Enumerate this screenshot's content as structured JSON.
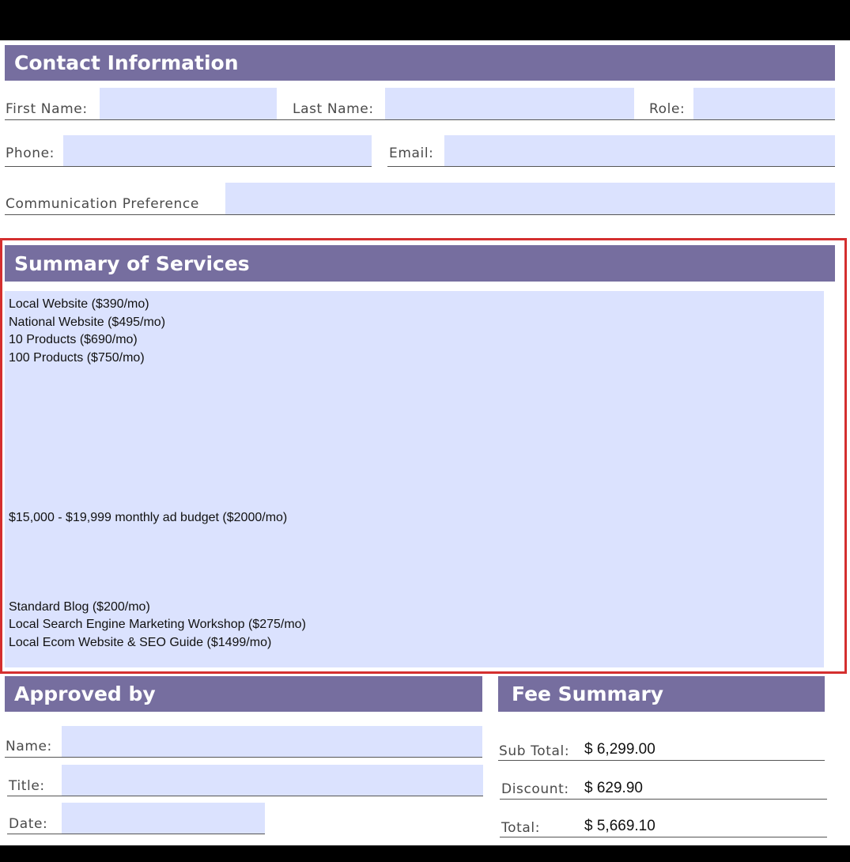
{
  "contact": {
    "header": "Contact Information",
    "first_name_label": "First Name:",
    "last_name_label": "Last Name:",
    "role_label": "Role:",
    "phone_label": "Phone:",
    "email_label": "Email:",
    "comm_pref_label": "Communication Preference",
    "first_name_value": "",
    "last_name_value": "",
    "role_value": "",
    "phone_value": "",
    "email_value": "",
    "comm_pref_value": ""
  },
  "services": {
    "header": "Summary of Services",
    "lines": [
      "Local Website ($390/mo)",
      "National Website ($495/mo)",
      "10 Products ($690/mo)",
      "100 Products ($750/mo)",
      "",
      "",
      "",
      "",
      "",
      "",
      "",
      "",
      "$15,000 - $19,999 monthly ad budget ($2000/mo)",
      "",
      "",
      "",
      "",
      "Standard Blog ($200/mo)",
      "Local Search Engine Marketing Workshop ($275/mo)",
      "Local Ecom Website & SEO Guide ($1499/mo)"
    ]
  },
  "approved": {
    "header": "Approved by",
    "name_label": "Name:",
    "title_label": "Title:",
    "date_label": "Date:",
    "name_value": "",
    "title_value": "",
    "date_value": ""
  },
  "fees": {
    "header": "Fee Summary",
    "subtotal_label": "Sub Total:",
    "subtotal_value": "$ 6,299.00",
    "discount_label": "Discount:",
    "discount_value": "$ 629.90",
    "total_label": "Total:",
    "total_value": "$ 5,669.10"
  },
  "colors": {
    "header_bg": "#766e9f",
    "field_bg": "#dbe2fe",
    "highlight_border": "#d42f2f"
  }
}
